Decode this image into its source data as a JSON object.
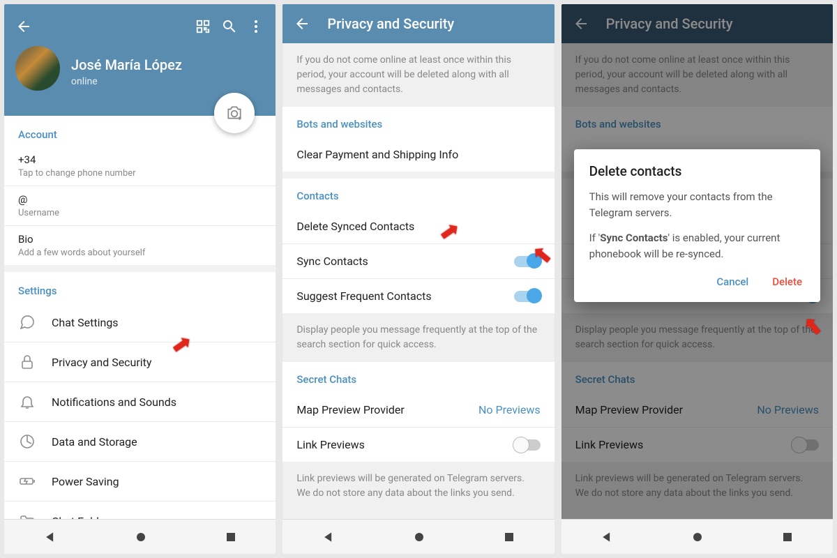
{
  "colors": {
    "header": "#5a8cb0",
    "accent": "#4a90c2",
    "danger": "#e74c3c"
  },
  "screen1": {
    "user_name": "José María López",
    "user_status": "online",
    "account_header": "Account",
    "phone_value": "+34",
    "phone_hint": "Tap to change phone number",
    "username_value": "@",
    "username_hint": "Username",
    "bio_value": "Bio",
    "bio_hint": "Add a few words about yourself",
    "settings_header": "Settings",
    "items": {
      "chat": "Chat Settings",
      "privacy": "Privacy and Security",
      "notif": "Notifications and Sounds",
      "data": "Data and Storage",
      "power": "Power Saving",
      "folders": "Chat Folders"
    }
  },
  "screen2": {
    "title": "Privacy and Security",
    "delete_info": "If you do not come online at least once within this period, your account will be deleted along with all messages and contacts.",
    "bots_header": "Bots and websites",
    "clear_payment": "Clear Payment and Shipping Info",
    "contacts_header": "Contacts",
    "delete_synced": "Delete Synced Contacts",
    "sync_contacts": "Sync Contacts",
    "suggest_freq": "Suggest Frequent Contacts",
    "suggest_info": "Display people you message frequently at the top of the search section for quick access.",
    "secret_header": "Secret Chats",
    "map_preview": "Map Preview Provider",
    "map_value": "No Previews",
    "link_previews": "Link Previews",
    "link_info": "Link previews will be generated on Telegram servers. We do not store any data about the links you send."
  },
  "dialog": {
    "title": "Delete contacts",
    "body1": "This will remove your contacts from the Telegram servers.",
    "body2_pre": "If '",
    "body2_bold": "Sync Contacts",
    "body2_post": "' is enabled, your current phonebook will be re-synced.",
    "cancel": "Cancel",
    "delete": "Delete"
  }
}
